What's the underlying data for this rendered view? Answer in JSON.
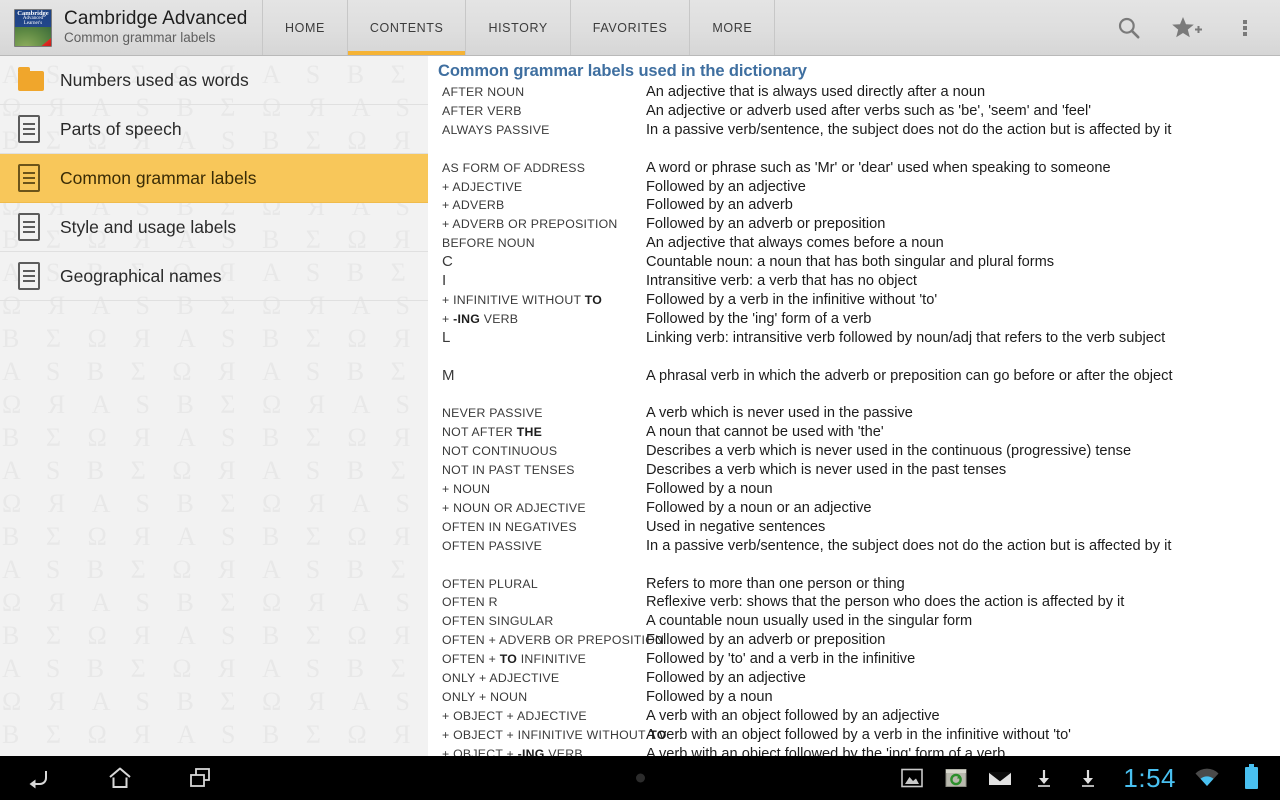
{
  "appbar": {
    "icon_name": "cambridge-dictionary-book-icon",
    "icon_lines": {
      "l1": "Cambridge",
      "l2": "Advanced",
      "l3": "Learner's",
      "ribbon": "audio"
    },
    "title": "Cambridge Advanced",
    "subtitle": "Common grammar labels",
    "tabs": [
      {
        "label": "HOME",
        "active": false
      },
      {
        "label": "CONTENTS",
        "active": true
      },
      {
        "label": "HISTORY",
        "active": false
      },
      {
        "label": "FAVORITES",
        "active": false
      },
      {
        "label": "MORE",
        "active": false
      }
    ],
    "actions": [
      {
        "name": "search-icon",
        "label": "Search"
      },
      {
        "name": "add-favorite-star-icon",
        "label": "Add to favorites"
      },
      {
        "name": "overflow-menu-icon",
        "label": "More options"
      }
    ],
    "accent_color": "#f5b335",
    "bar_color": "#dedede"
  },
  "sidebar": {
    "watermark_text": "A S B Σ Ω Я A S B Σ Ω Я A S B Σ Ω Я A S B Σ Ω Я A S B Σ Ω Я A S B Σ Ω Я A S B Σ Ω Я A S B Σ Ω Я A S B Σ Ω Я A S B Σ Ω Я A S B Σ Ω Я A S B Σ Ω Я A S B Σ Ω Я A S B Σ Ω Я A S B Σ Ω Я A S B Σ Ω Я A S B Σ Ω Я A S B Σ Ω Я A S B Σ Ω Я A S B Σ Ω Я A S B Σ Ω Я A S B Σ Ω Я A S B Σ Ω Я A S B Σ Ω Я A S B Σ Ω Я A S B Σ Ω Я A S B Σ Ω Я A S B Σ Ω Я A S B Σ Ω Я A S B Σ Ω Я A S B Σ Ω Я A S B Σ Ω Я A S B Σ Ω Я A S B Σ Ω Я A S B Σ Ω Я A S B Σ Ω Я A S B Σ Ω Я A S B Σ Ω Я A S B Σ Ω Я A S B Σ Ω Я A S B Σ Ω Я A S B Σ Ω Я A S B Σ Ω Я A S B Σ Ω Я A S B Σ Ω Я A S B Σ Ω Я A S B Σ Ω Я A S B Σ Ω Я A S B Σ Ω Я A S B Σ Ω Я A S B Σ Ω Я",
    "selected_color": "#f8c75a",
    "items": [
      {
        "label": "Numbers used as words",
        "icon": "folder-icon",
        "selected": false
      },
      {
        "label": "Parts of speech",
        "icon": "document-icon",
        "selected": false
      },
      {
        "label": "Common grammar labels",
        "icon": "document-icon",
        "selected": true
      },
      {
        "label": "Style and usage labels",
        "icon": "document-icon",
        "selected": false
      },
      {
        "label": "Geographical names",
        "icon": "document-icon",
        "selected": false
      }
    ]
  },
  "content": {
    "title": "Common grammar labels used in the dictionary",
    "title_color": "#3f6fa0",
    "rows": [
      {
        "label": "AFTER NOUN",
        "desc": "An adjective that is always used directly after a noun"
      },
      {
        "label": "AFTER VERB",
        "desc": "An adjective or adverb used after verbs such as 'be', 'seem' and 'feel'"
      },
      {
        "label": "ALWAYS PASSIVE",
        "desc": "In a passive verb/sentence, the subject does not do the action but is affected by it"
      },
      {
        "label": "AS FORM OF ADDRESS",
        "desc": "A word or phrase such as 'Mr' or 'dear' used when speaking to someone",
        "gap": true
      },
      {
        "label": "+ ADJECTIVE",
        "desc": "Followed by an adjective"
      },
      {
        "label": "+ ADVERB",
        "desc": "Followed by an adverb"
      },
      {
        "label": "+ ADVERB OR PREPOSITION",
        "desc": "Followed by an adverb or preposition"
      },
      {
        "label": "BEFORE NOUN",
        "desc": "An adjective that always comes before a noun"
      },
      {
        "label": "C",
        "big": true,
        "desc": "Countable noun: a noun that has both singular and plural forms"
      },
      {
        "label": "I",
        "big": true,
        "desc": "Intransitive verb: a verb that has no object"
      },
      {
        "label": "+ INFINITIVE WITHOUT TO",
        "bold_tail": "TO",
        "desc": "Followed by a verb in the infinitive without 'to'"
      },
      {
        "label": "+ -ING VERB",
        "bold_part": "-ING",
        "desc": "Followed by the 'ing' form of a verb"
      },
      {
        "label": "L",
        "big": true,
        "desc": "Linking verb: intransitive verb followed by noun/adj that refers to the verb subject"
      },
      {
        "label": "M",
        "big": true,
        "desc": "A phrasal verb in which the adverb or preposition can go before or after the object",
        "gap": true
      },
      {
        "label": "NEVER PASSIVE",
        "desc": "A verb which is never used in the passive",
        "gap": true
      },
      {
        "label": "NOT AFTER THE",
        "bold_tail": "THE",
        "desc": "A noun that cannot be used with 'the'"
      },
      {
        "label": "NOT CONTINUOUS",
        "desc": "Describes a verb which is never used in the continuous (progressive) tense"
      },
      {
        "label": "NOT IN PAST TENSES",
        "desc": "Describes a verb which is never used in the past tenses"
      },
      {
        "label": "+ NOUN",
        "desc": "Followed by a noun"
      },
      {
        "label": "+ NOUN OR ADJECTIVE",
        "desc": "Followed by a noun or an adjective"
      },
      {
        "label": "OFTEN IN NEGATIVES",
        "desc": "Used in negative sentences"
      },
      {
        "label": "OFTEN PASSIVE",
        "desc": "In a passive verb/sentence, the subject does not do the action but is affected by it"
      },
      {
        "label": "OFTEN PLURAL",
        "desc": "Refers to more than one person or thing",
        "gap": true
      },
      {
        "label": "OFTEN R",
        "big_tail": "R",
        "desc": "Reflexive verb: shows that the person who does the action is affected by it"
      },
      {
        "label": "OFTEN SINGULAR",
        "desc": "A countable noun usually used in the singular form"
      },
      {
        "label": "OFTEN + ADVERB OR PREPOSITION",
        "desc": "Followed by an adverb or preposition"
      },
      {
        "label": "OFTEN + TO INFINITIVE",
        "bold_part": "TO",
        "desc": "Followed by 'to' and a verb in the infinitive"
      },
      {
        "label": "ONLY + ADJECTIVE",
        "desc": "Followed by an adjective"
      },
      {
        "label": "ONLY + NOUN",
        "desc": "Followed by a noun"
      },
      {
        "label": "+ OBJECT + ADJECTIVE",
        "desc": "A verb with an object followed by an adjective"
      },
      {
        "label": "+ OBJECT + INFINITIVE WITHOUT TO",
        "bold_tail": "TO",
        "desc": "A verb with an object followed by a verb in the infinitive without 'to'"
      },
      {
        "label": "+ OBJECT + -ING VERB",
        "bold_part": "-ING",
        "desc": "A verb with an object followed by the 'ing' form of a verb"
      }
    ]
  },
  "sysbar": {
    "nav": [
      {
        "name": "back-icon",
        "label": "Back"
      },
      {
        "name": "home-icon",
        "label": "Home"
      },
      {
        "name": "recent-apps-icon",
        "label": "Recent apps"
      }
    ],
    "notification_dot": "notification-dot",
    "status_icons": [
      {
        "name": "gallery-image-icon"
      },
      {
        "name": "screenshot-app-icon"
      },
      {
        "name": "email-icon"
      },
      {
        "name": "download-icon"
      },
      {
        "name": "download-icon"
      }
    ],
    "clock": "1:54",
    "wifi": "wifi-icon",
    "battery": "battery-icon",
    "accent_color": "#49c0f0"
  }
}
